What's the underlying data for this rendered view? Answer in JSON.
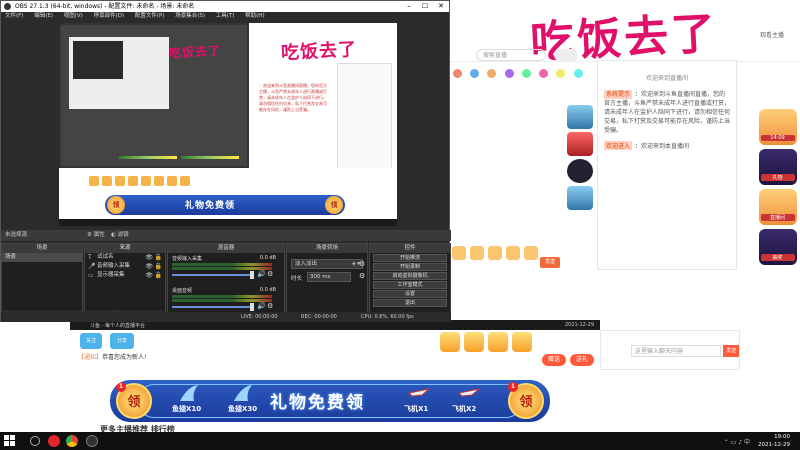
{
  "overlay": {
    "handwriting": "吃饭去了"
  },
  "browser_bg": {
    "watch_label": "观看主播",
    "search_placeholder": "搜索直播",
    "chat_header": "欢迎来到直播间",
    "system_notice_tag": "系统提示",
    "system_notice_text": "：欢迎来到斗鱼直播间直播，您的官方主播，斗鱼严禁未成年人进行直播或打赏，请未成年人在监护人陪同下进行，请勿相信任何交易，私下打赏及交易可能存在风险，谨防上当受骗。",
    "welcome_tag": "欢迎进入",
    "welcome_text": "：欢迎来到本直播间",
    "sidebar_badges": [
      "14:09",
      "礼物",
      "直播间",
      "抽奖"
    ],
    "small_send_label": "发送"
  },
  "lower_browser": {
    "tab_left": "斗鱼 - 每个人的直播平台",
    "tab_right": "2021-12-29",
    "btn_follow": "关注",
    "btn_share": "分享",
    "notice_tag": "【通知】",
    "notice_text": "恭喜您成为新人!",
    "send_gift": "赠送",
    "send_gift2": "送礼",
    "chat_placeholder": "这里输入聊天内容",
    "chat_send": "发送",
    "bottom_text": "更多主播推荐   排行榜"
  },
  "gift_banner": {
    "title": "礼物免费领",
    "claim": "领",
    "badge_count": "1",
    "items": [
      "鱼翅X10",
      "鱼翅X30",
      "飞机X1",
      "飞机X2"
    ]
  },
  "obs": {
    "title": "OBS 27.1.3 (64-bit, windows) - 配置文件: 未命名 - 场景: 未命名",
    "menu": [
      "文件(F)",
      "编辑(E)",
      "视图(V)",
      "停靠部件(D)",
      "配置文件(P)",
      "场景集合(S)",
      "工具(T)",
      "帮助(H)"
    ],
    "scene_bar_label": "未选择源",
    "scene_bar_props": "属性",
    "scene_bar_filters": "滤镜",
    "docks": {
      "scenes": {
        "title": "场景",
        "items": [
          "场景"
        ]
      },
      "sources": {
        "title": "来源",
        "items": [
          "试试名",
          "音频输入采集",
          "显示器采集"
        ]
      },
      "mixer": {
        "title": "混音器",
        "channels": [
          {
            "name": "音频输入采集",
            "db": "0.0 dB"
          },
          {
            "name": "桌面音频",
            "db": "0.0 dB"
          }
        ]
      },
      "transitions": {
        "title": "场景转场",
        "type": "淡入淡出",
        "duration_label": "时长",
        "duration": "300 ms"
      },
      "controls": {
        "title": "控件",
        "buttons": [
          "开始推流",
          "开始录制",
          "启动虚拟摄像机",
          "工作室模式",
          "设置",
          "退出"
        ]
      }
    },
    "status": {
      "live": "LIVE: 00:00:00",
      "rec": "REC: 00:00:00",
      "cpu": "CPU: 0.6%, 60.00 fps"
    }
  },
  "taskbar": {
    "time": "19:00",
    "date": "2021-12-29"
  }
}
